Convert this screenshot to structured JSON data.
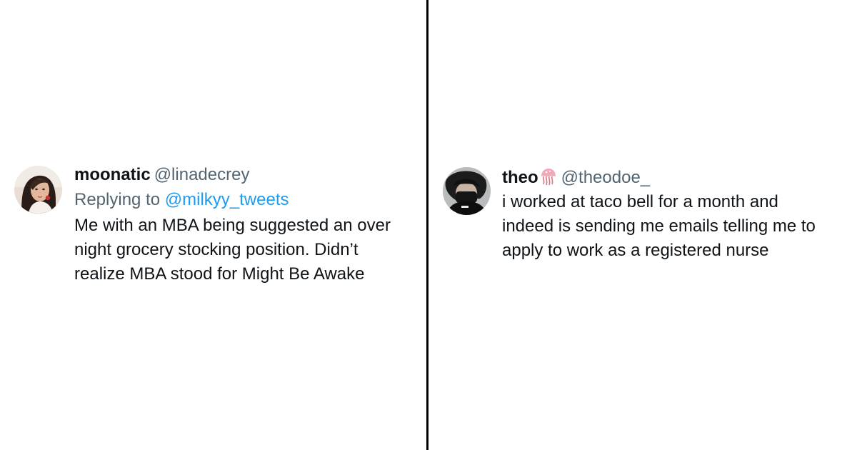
{
  "left_tweet": {
    "display_name": "moonatic",
    "handle": "@linadecrey",
    "reply_prefix": "Replying to",
    "reply_mention": "@milkyy_tweets",
    "text": "Me with an MBA being suggested an over\nnight grocery stocking position. Didn’t\nrealize MBA stood for Might Be Awake"
  },
  "right_tweet": {
    "display_name": "theo",
    "name_emoji": "jellyfish-icon",
    "handle": "@theodoe_",
    "text": "i worked at taco bell for a month and\nindeed is sending me emails telling me to\napply to work as a registered nurse"
  },
  "colors": {
    "text_primary": "#0f1419",
    "text_secondary": "#536471",
    "mention": "#1d9bf0",
    "divider": "#000000",
    "background": "#ffffff"
  }
}
